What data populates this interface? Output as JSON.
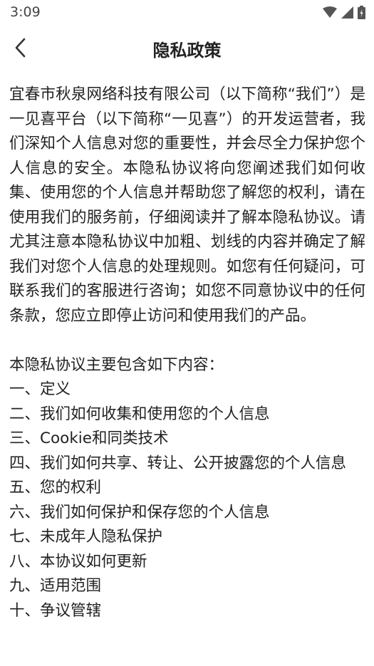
{
  "status_bar": {
    "time": "3:09",
    "icons": [
      "wifi-icon",
      "signal-icon",
      "battery-icon"
    ]
  },
  "header": {
    "back_icon": "chevron-left-icon",
    "title": "隐私政策"
  },
  "policy": {
    "intro": "宜春市秋泉网络科技有限公司（以下简称“我们”）是一见喜平台（以下简称“一见喜”）的开发运营者，我们深知个人信息对您的重要性，并会尽全力保护您个人信息的安全。本隐私协议将向您阐述我们如何收集、使用您的个人信息并帮助您了解您的权利，请在使用我们的服务前，仔细阅读并了解本隐私协议。请尤其注意本隐私协议中加粗、划线的内容并确定了解我们对您个人信息的处理规则。如您有任何疑问，可联系我们的客服进行咨询；如您不同意协议中的任何条款，您应立即停止访问和使用我们的产品。",
    "toc_heading": "本隐私协议主要包含如下内容：",
    "toc_items": [
      "一、定义",
      "二、我们如何收集和使用您的个人信息",
      "三、Cookie和同类技术",
      "四、我们如何共享、转让、公开披露您的个人信息",
      "五、您的权利",
      "六、我们如何保护和保存您的个人信息",
      "七、未成年人隐私保护",
      "八、本协议如何更新",
      "九、适用范围",
      "十、争议管辖"
    ]
  }
}
